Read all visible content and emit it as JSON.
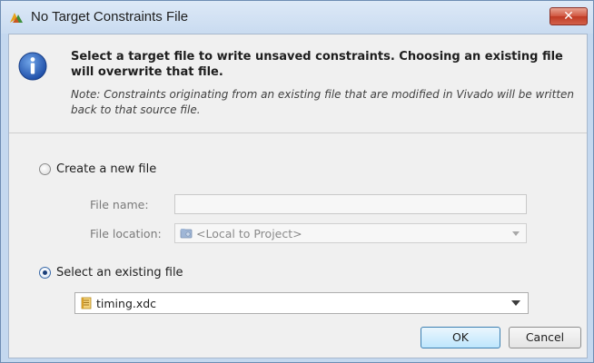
{
  "window": {
    "title": "No Target Constraints File",
    "close_glyph": "✕",
    "title_icon": "vivado-logo-icon",
    "close_color": "#c94e3a"
  },
  "message": {
    "icon": "info-icon",
    "heading": "Select a target file to write unsaved constraints. Choosing an existing file will overwrite that file.",
    "note": "Note: Constraints originating from an existing file that are modified in Vivado will be written back to that source file."
  },
  "option_new": {
    "label": "Create a new file",
    "selected": false,
    "file_name_label": "File name:",
    "file_name_value": "",
    "file_location_label": "File location:",
    "file_location_value": "<Local to Project>",
    "file_location_icon": "folder-icon"
  },
  "option_existing": {
    "label": "Select an existing file",
    "selected": true,
    "file_value": "timing.xdc",
    "file_icon": "constraints-file-icon"
  },
  "buttons": {
    "ok": "OK",
    "cancel": "Cancel"
  }
}
